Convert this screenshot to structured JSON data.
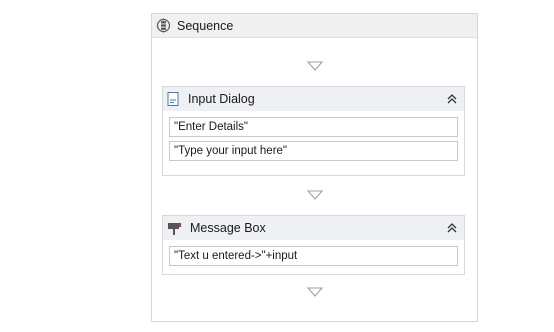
{
  "sequence": {
    "title": "Sequence",
    "icon": "sequence-icon"
  },
  "input_dialog": {
    "title": "Input Dialog",
    "icon": "input-dialog-icon",
    "collapse_icon": "chevron-double-up-icon",
    "title_field": "\"Enter Details\"",
    "label_field": "\"Type your input here\""
  },
  "message_box": {
    "title": "Message Box",
    "icon": "message-box-icon",
    "collapse_icon": "chevron-double-up-icon",
    "text_field": "\"Text u entered->\"+input"
  },
  "colors": {
    "header_bg": "#eef0f3",
    "border": "#d6d6d6",
    "drop_arrow": "#9aa3ad"
  }
}
